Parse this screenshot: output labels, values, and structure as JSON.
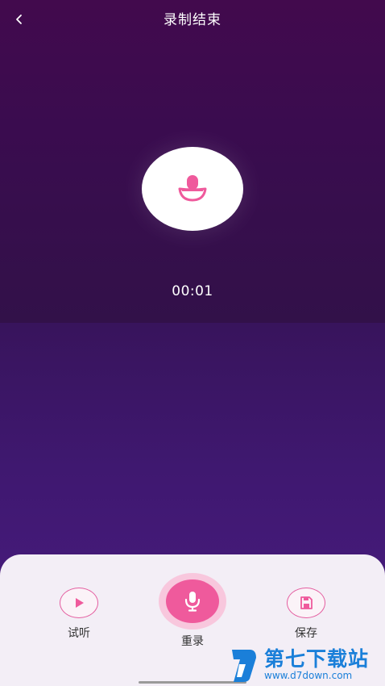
{
  "header": {
    "title": "录制结束",
    "back_icon": "chevron-left-icon"
  },
  "recording": {
    "status_icon": "microphone-icon",
    "duration": "00:01"
  },
  "controls": {
    "listen_label": "试听",
    "listen_icon": "play-icon",
    "rerecord_label": "重录",
    "rerecord_icon": "microphone-icon",
    "save_label": "保存",
    "save_icon": "save-icon"
  },
  "watermark": {
    "name": "第七下载站",
    "url": "www.d7down.com"
  },
  "colors": {
    "accent": "#ef5a9c",
    "background_top": "#3c0847",
    "background_bottom": "#4a1d85",
    "panel": "#f3eef6"
  }
}
